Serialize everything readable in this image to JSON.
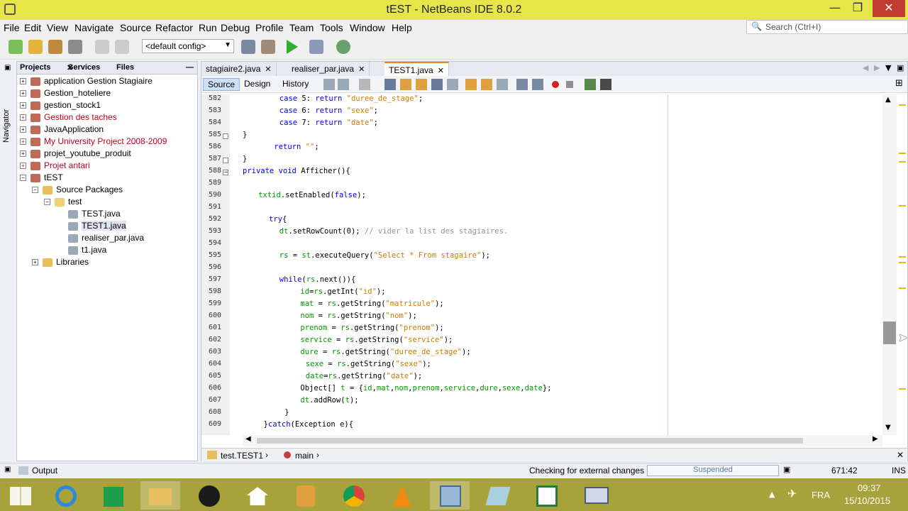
{
  "window": {
    "title": "tEST - NetBeans IDE 8.0.2",
    "min": "—",
    "max": "❐",
    "close": "✕"
  },
  "menu": [
    "File",
    "Edit",
    "View",
    "Navigate",
    "Source",
    "Refactor",
    "Run",
    "Debug",
    "Profile",
    "Team",
    "Tools",
    "Window",
    "Help"
  ],
  "search": {
    "placeholder": "Search (Ctrl+I)"
  },
  "toolbar": {
    "config": "<default config>"
  },
  "side": {
    "navigator": "Navigator"
  },
  "projects": {
    "tabs": [
      "Projects",
      "Services",
      "Files"
    ],
    "minimize": "—",
    "items": [
      {
        "label": "application Gestion Stagiaire",
        "red": false
      },
      {
        "label": "Gestion_hoteliere",
        "red": false
      },
      {
        "label": "gestion_stock1",
        "red": false
      },
      {
        "label": "Gestion des taches",
        "red": true
      },
      {
        "label": "JavaApplication",
        "red": false
      },
      {
        "label": "My University Project 2008-2009",
        "red": true
      },
      {
        "label": "projet_youtube_produit",
        "red": false
      },
      {
        "label": "Projet antari",
        "red": true
      },
      {
        "label": "tEST",
        "red": false
      },
      {
        "label": "Source Packages",
        "red": false
      },
      {
        "label": "test",
        "red": false
      },
      {
        "label": "TEST.java",
        "red": false
      },
      {
        "label": "TEST1.java",
        "red": false
      },
      {
        "label": "realiser_par.java",
        "red": false
      },
      {
        "label": "t1.java",
        "red": false
      },
      {
        "label": "Libraries",
        "red": false
      }
    ]
  },
  "editor": {
    "tabs": [
      {
        "label": "stagiaire2.java"
      },
      {
        "label": "realiser_par.java"
      },
      {
        "label": "TEST1.java"
      }
    ],
    "views": [
      "Source",
      "Design",
      "History"
    ],
    "lines": [
      {
        "n": "582",
        "indent": 7,
        "html": "case 5: return \"duree_de_stage\";"
      },
      {
        "n": "583",
        "indent": 7,
        "html": "case 6: return \"sexe\";"
      },
      {
        "n": "584",
        "indent": 7,
        "html": "case 7: return \"date\";"
      },
      {
        "n": "585",
        "indent": 0,
        "html": "}"
      },
      {
        "n": "586",
        "indent": 6,
        "html": "return \"\";"
      },
      {
        "n": "587",
        "indent": 0,
        "html": "}"
      },
      {
        "n": "588",
        "indent": 0,
        "html": "private void Afficher(){"
      },
      {
        "n": "589",
        "indent": 0,
        "html": ""
      },
      {
        "n": "590",
        "indent": 3,
        "html": "txtid.setEnabled(false);"
      },
      {
        "n": "591",
        "indent": 0,
        "html": ""
      },
      {
        "n": "592",
        "indent": 5,
        "html": "try{"
      },
      {
        "n": "593",
        "indent": 7,
        "html": "dt.setRowCount(0); // vider la list des stagiaires."
      },
      {
        "n": "594",
        "indent": 0,
        "html": ""
      },
      {
        "n": "595",
        "indent": 7,
        "html": "rs = st.executeQuery(\"Select * From stagaire\");"
      },
      {
        "n": "596",
        "indent": 0,
        "html": ""
      },
      {
        "n": "597",
        "indent": 7,
        "html": "while(rs.next()){"
      },
      {
        "n": "598",
        "indent": 11,
        "html": "id=rs.getInt(\"id\");"
      },
      {
        "n": "599",
        "indent": 11,
        "html": "mat = rs.getString(\"matricule\");"
      },
      {
        "n": "600",
        "indent": 11,
        "html": "nom = rs.getString(\"nom\");"
      },
      {
        "n": "601",
        "indent": 11,
        "html": "prenom = rs.getString(\"prenom\");"
      },
      {
        "n": "602",
        "indent": 11,
        "html": "service = rs.getString(\"service\");"
      },
      {
        "n": "603",
        "indent": 11,
        "html": "dure = rs.getString(\"duree_de_stage\");"
      },
      {
        "n": "604",
        "indent": 12,
        "html": "sexe = rs.getString(\"sexe\");"
      },
      {
        "n": "605",
        "indent": 12,
        "html": "date=rs.getString(\"date\");"
      },
      {
        "n": "606",
        "indent": 11,
        "html": "Object[] t = {id,mat,nom,prenom,service,dure,sexe,date};"
      },
      {
        "n": "607",
        "indent": 11,
        "html": "dt.addRow(t);"
      },
      {
        "n": "608",
        "indent": 8,
        "html": "}"
      },
      {
        "n": "609",
        "indent": 4,
        "html": "}catch(Exception e){"
      }
    ],
    "breadcrumb": [
      "test.TEST1",
      "main"
    ]
  },
  "status": {
    "output": "Output",
    "checking": "Checking for external changes",
    "suspended": "Suspended",
    "position": "671:42",
    "mode": "INS"
  },
  "taskbar": {
    "lang": "FRA",
    "time": "09:37",
    "date": "15/10/2015"
  }
}
